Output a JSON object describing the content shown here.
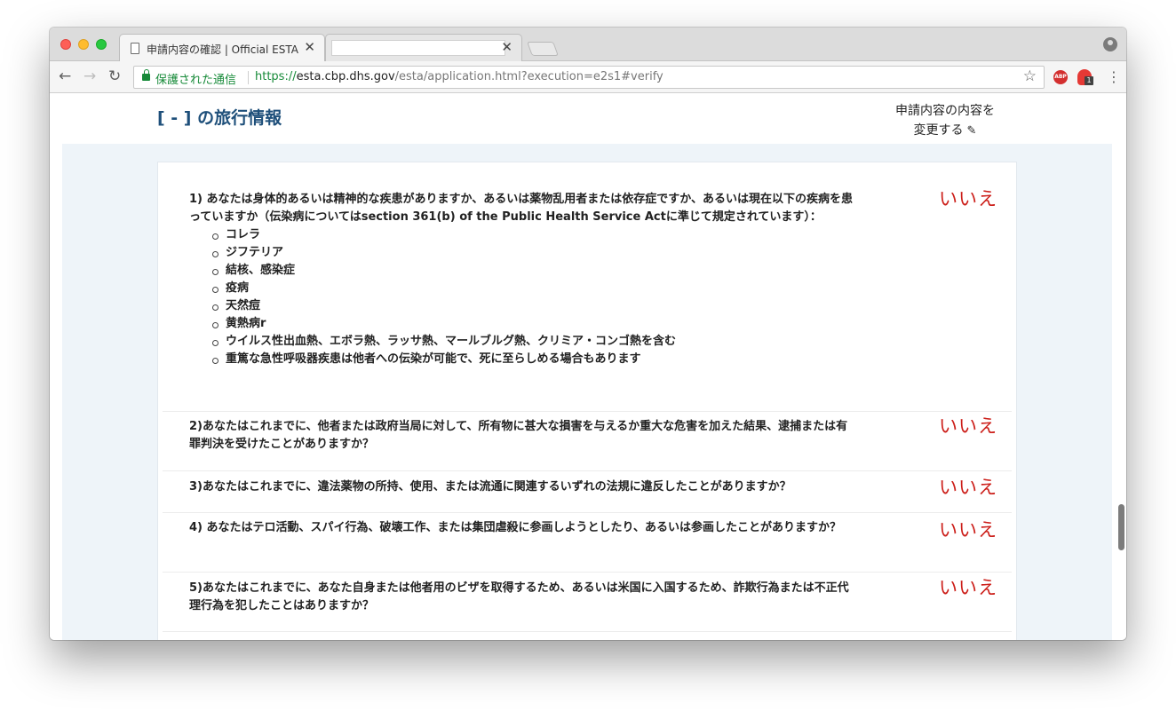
{
  "browser": {
    "active_tab_title": "申請内容の確認 | Official ESTA",
    "inactive_tab_title": "",
    "tab_close": "✕",
    "secure_label": "保護された通信",
    "url_scheme": "https://",
    "url_host": "esta.cbp.dhs.gov",
    "url_path": "/esta/application.html?execution=e2s1#verify",
    "ext_abp_label": "ABP",
    "ext_badge": "1"
  },
  "page": {
    "section_title": "[ - ] の旅行情報",
    "edit_link_line1": "申請内容の内容を",
    "edit_link_line2": "変更する"
  },
  "questions": [
    {
      "text": "1) あなたは身体的あるいは精神的な疾患がありますか、あるいは薬物乱用者または依存症ですか、あるいは現在以下の疾病を患っていますか（伝染病についてはsection 361(b) of the Public Health Service Actに準じて規定されています）：",
      "items": [
        "コレラ",
        "ジフテリア",
        "結核、感染症",
        "疫病",
        "天然痘",
        "黄熱病r",
        "ウイルス性出血熱、エボラ熱、ラッサ熱、マールブルグ熱、クリミア・コンゴ熱を含む",
        "重篤な急性呼吸器疾患は他者への伝染が可能で、死に至らしめる場合もあります"
      ],
      "answer": "いいえ"
    },
    {
      "text": "2)あなたはこれまでに、他者または政府当局に対して、所有物に甚大な損害を与えるか重大な危害を加えた結果、逮捕または有罪判決を受けたことがありますか？",
      "answer": "いいえ"
    },
    {
      "text": "3)あなたはこれまでに、違法薬物の所持、使用、または流通に関連するいずれの法規に違反したことがありますか？",
      "answer": "いいえ"
    },
    {
      "text": "4) あなたはテロ活動、スパイ行為、破壊工作、または集団虐殺に参画しようとしたり、あるいは参画したことがありますか？",
      "answer": "いいえ"
    },
    {
      "text": "5)あなたはこれまでに、あなた自身または他者用のビザを取得するため、あるいは米国に入国するため、詐欺行為または不正代理行為を犯したことはありますか？",
      "answer": "いいえ"
    }
  ]
}
